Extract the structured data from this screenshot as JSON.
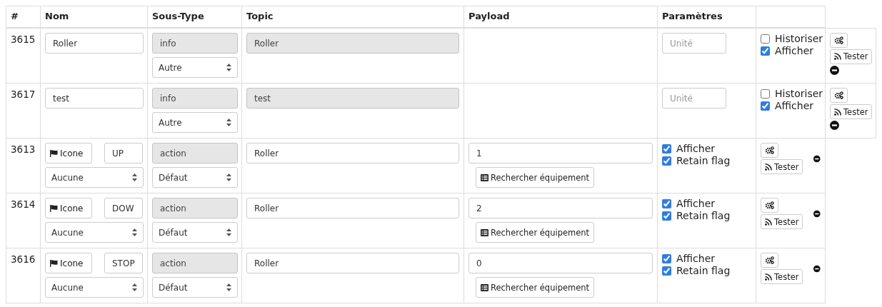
{
  "table": {
    "columns": [
      "#",
      "Nom",
      "Sous-Type",
      "Topic",
      "Payload",
      "Paramètres"
    ],
    "rows": [
      {
        "kind": "info",
        "id": "3615",
        "name": "Roller",
        "subtype": "info",
        "subtype_select": "Autre",
        "topic": {
          "value": "Roller",
          "disabled": true
        },
        "unit_placeholder": "Unité",
        "checkboxes": [
          {
            "label": "Historiser",
            "checked": false
          },
          {
            "label": "Afficher",
            "checked": true
          }
        ],
        "test_button": "Tester"
      },
      {
        "kind": "info",
        "id": "3617",
        "name": "test",
        "subtype": "info",
        "subtype_select": "Autre",
        "topic": {
          "value": "test",
          "disabled": true
        },
        "unit_placeholder": "Unité",
        "checkboxes": [
          {
            "label": "Historiser",
            "checked": false
          },
          {
            "label": "Afficher",
            "checked": true
          }
        ],
        "test_button": "Tester"
      },
      {
        "kind": "action",
        "id": "3613",
        "icon_button": "Icone",
        "name": "UP",
        "name_select": "Aucune",
        "subtype": "action",
        "subtype_select": "Défaut",
        "topic": {
          "value": "Roller",
          "disabled": false
        },
        "payload": "1",
        "search_button": "Rechercher équipement",
        "checkboxes": [
          {
            "label": "Afficher",
            "checked": true
          },
          {
            "label": "Retain flag",
            "checked": true
          }
        ],
        "test_button": "Tester"
      },
      {
        "kind": "action",
        "id": "3614",
        "icon_button": "Icone",
        "name": "DOW",
        "name_select": "Aucune",
        "subtype": "action",
        "subtype_select": "Défaut",
        "topic": {
          "value": "Roller",
          "disabled": false
        },
        "payload": "2",
        "search_button": "Rechercher équipement",
        "checkboxes": [
          {
            "label": "Afficher",
            "checked": true
          },
          {
            "label": "Retain flag",
            "checked": true
          }
        ],
        "test_button": "Tester"
      },
      {
        "kind": "action",
        "id": "3616",
        "icon_button": "Icone",
        "name": "STOP",
        "name_select": "Aucune",
        "subtype": "action",
        "subtype_select": "Défaut",
        "topic": {
          "value": "Roller",
          "disabled": false
        },
        "payload": "0",
        "search_button": "Rechercher équipement",
        "checkboxes": [
          {
            "label": "Afficher",
            "checked": true
          },
          {
            "label": "Retain flag",
            "checked": true
          }
        ],
        "test_button": "Tester"
      }
    ]
  }
}
